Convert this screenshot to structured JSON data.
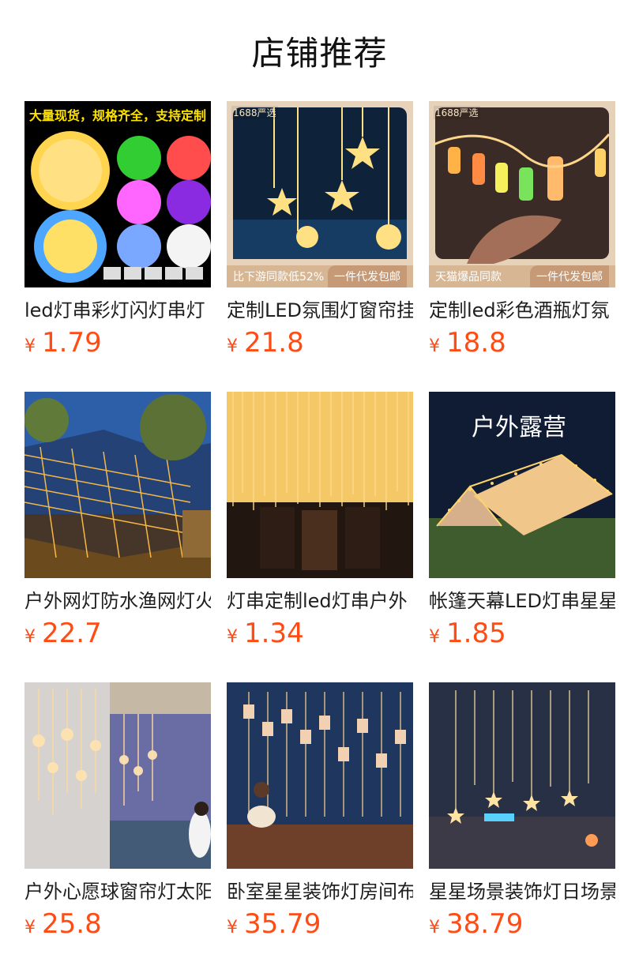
{
  "page": {
    "title": "店铺推荐"
  },
  "products": [
    {
      "name": "led灯串彩灯闪灯串灯",
      "currency": "¥",
      "price": "1.79",
      "image_text": "大量现货，规格齐全，支持定制"
    },
    {
      "name": "定制LED氛围灯窗帘挂",
      "currency": "¥",
      "price": "21.8",
      "image_badge": "1688严选",
      "image_left": "比下游同款低52%",
      "image_right": "一件代发包邮"
    },
    {
      "name": "定制led彩色酒瓶灯氛",
      "currency": "¥",
      "price": "18.8",
      "image_badge": "1688严选",
      "image_left": "天猫爆品同款",
      "image_right": "一件代发包邮"
    },
    {
      "name": "户外网灯防水渔网灯火",
      "currency": "¥",
      "price": "22.7"
    },
    {
      "name": "灯串定制led灯串户外",
      "currency": "¥",
      "price": "1.34"
    },
    {
      "name": "帐篷天幕LED灯串星星",
      "currency": "¥",
      "price": "1.85",
      "image_text": "户外露营"
    },
    {
      "name": "户外心愿球窗帘灯太阳",
      "currency": "¥",
      "price": "25.8"
    },
    {
      "name": "卧室星星装饰灯房间布",
      "currency": "¥",
      "price": "35.79"
    },
    {
      "name": "星星场景装饰灯日场景",
      "currency": "¥",
      "price": "38.79"
    }
  ],
  "colors": {
    "price": "#ff4b14",
    "title": "#111111",
    "text": "#1f1f1f"
  },
  "icons": {
    "thumbnail-placeholder": "product-image"
  }
}
